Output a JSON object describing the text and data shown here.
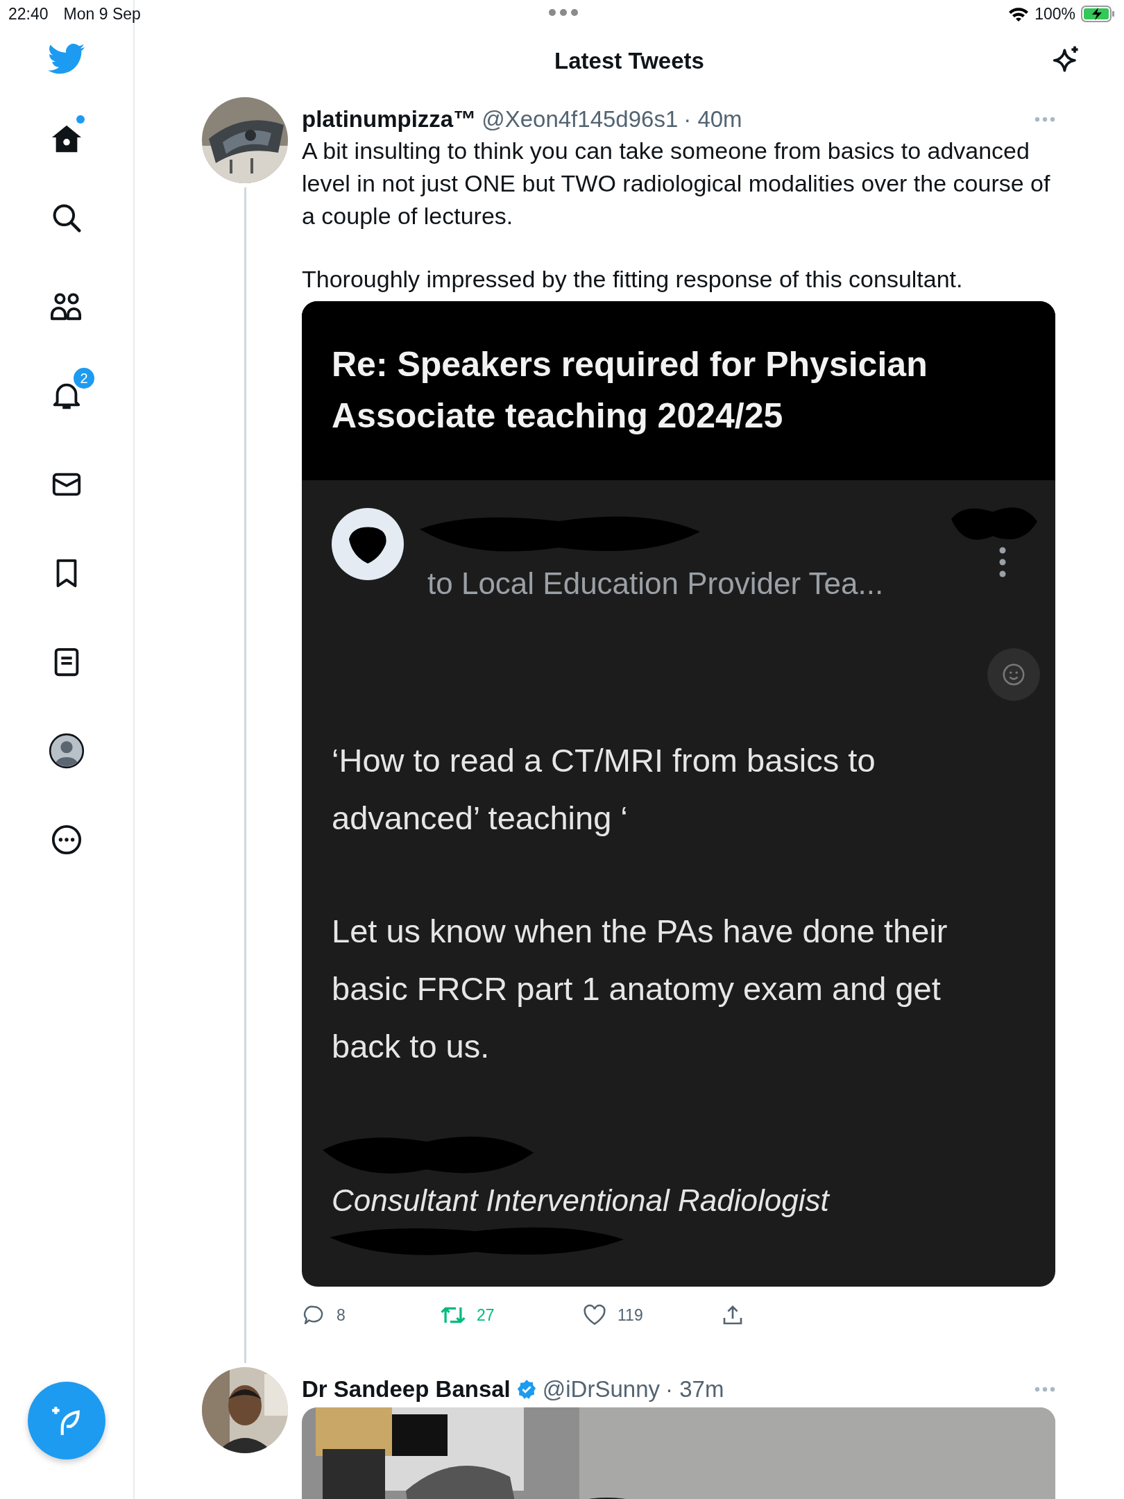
{
  "status_bar": {
    "time": "22:40",
    "date": "Mon 9 Sep",
    "battery": "100%"
  },
  "header": {
    "title": "Latest Tweets"
  },
  "nav": [
    {
      "kind": "home",
      "selected": true,
      "dot": true
    },
    {
      "kind": "search",
      "selected": false
    },
    {
      "kind": "communities",
      "selected": false
    },
    {
      "kind": "notifications",
      "selected": false,
      "badge": "2"
    },
    {
      "kind": "messages",
      "selected": false
    },
    {
      "kind": "bookmarks",
      "selected": false
    },
    {
      "kind": "lists",
      "selected": false
    },
    {
      "kind": "profile",
      "selected": false
    },
    {
      "kind": "more",
      "selected": false
    }
  ],
  "tweets": [
    {
      "name": "platinumpizza™",
      "verified": false,
      "handle": "@Xeon4f145d96s1",
      "time": "· 40m",
      "thread": true,
      "paragraphs": [
        "A bit insulting to think you can take someone from basics to advanced level in not just ONE but TWO radiological modalities over the course of a couple of lectures.",
        "Thoroughly impressed by the fitting response of this consultant."
      ],
      "media": {
        "kind": "email",
        "subject": "Re: Speakers required for Physician Associate teaching 2024/25",
        "recipient": "to Local Education Provider Tea...",
        "body": [
          "‘How to read a CT/MRI from basics to advanced’ teaching ‘",
          "Let us know when the PAs have done their basic FRCR part 1 anatomy exam and get back to us."
        ],
        "signature": "Consultant Interventional Radiologist"
      },
      "actions": {
        "replies": "8",
        "retweets": "27",
        "retweeted": true,
        "likes": "119"
      }
    },
    {
      "name": "Dr Sandeep Bansal",
      "verified": true,
      "handle": "@iDrSunny",
      "time": "· 37m",
      "thread": false
    }
  ]
}
